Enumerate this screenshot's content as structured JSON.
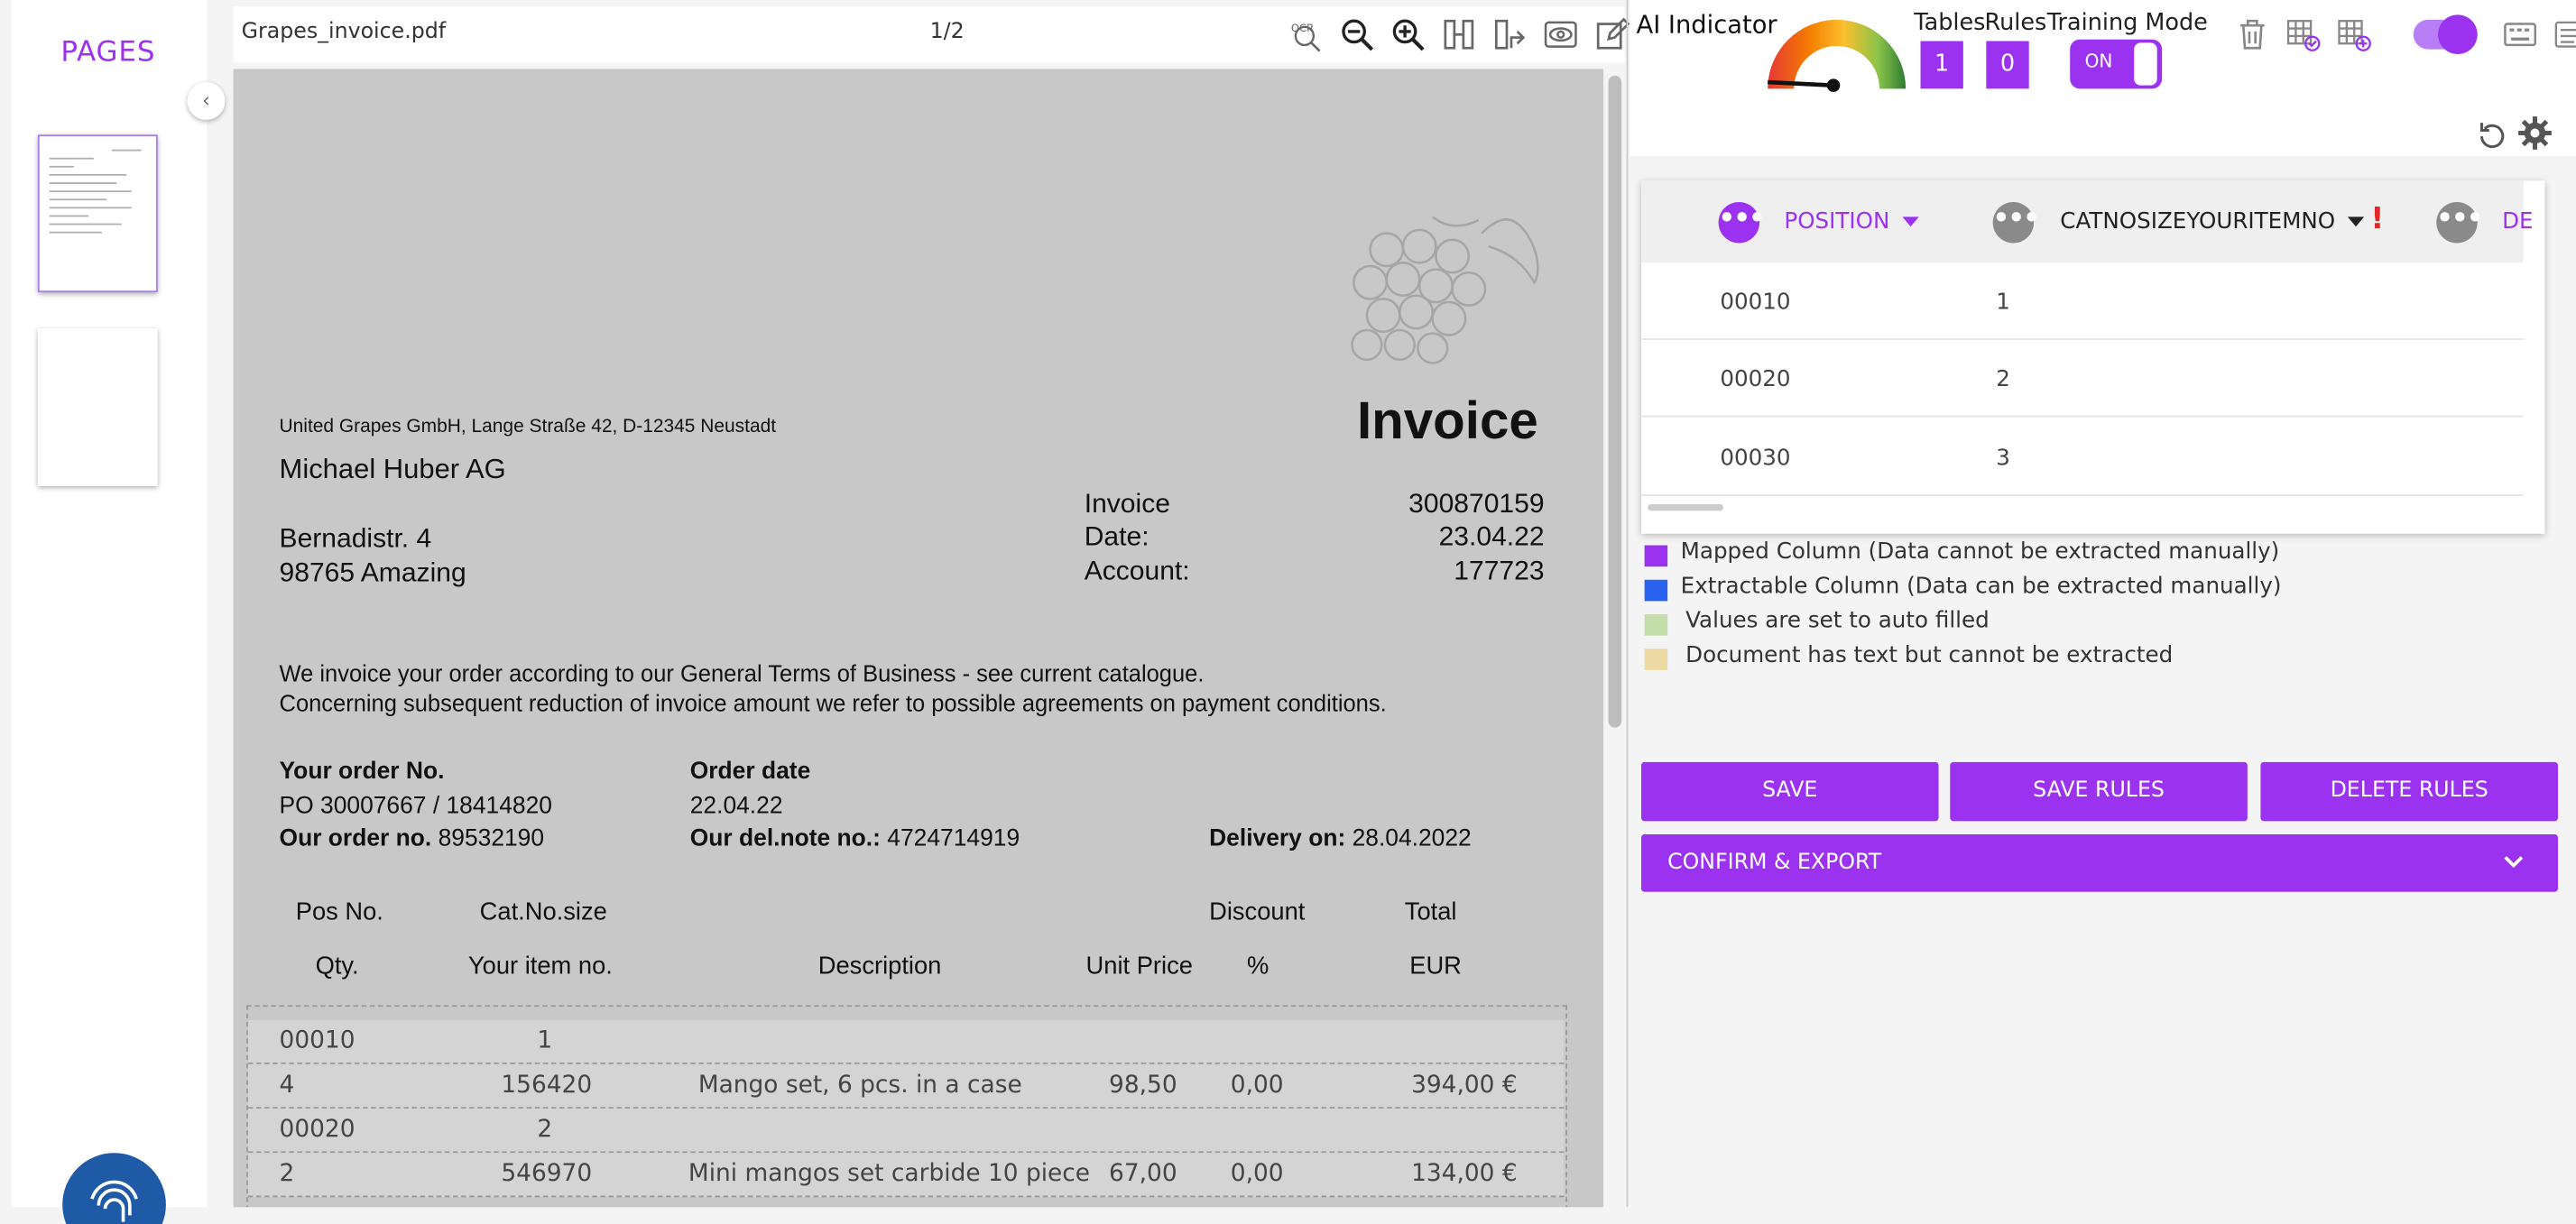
{
  "pages_panel": {
    "title": "PAGES"
  },
  "pdf_toolbar": {
    "file_name": "Grapes_invoice.pdf",
    "page_counter": "1/2",
    "ocr_label": "OCR"
  },
  "invoice": {
    "heading": "Invoice",
    "sender_line": "United Grapes GmbH, Lange Straße 42, D-12345 Neustadt",
    "recipient": {
      "name": "Michael Huber AG",
      "street": "Bernadistr. 4",
      "city": "98765 Amazing"
    },
    "meta": [
      {
        "label": "Invoice",
        "value": "300870159"
      },
      {
        "label": "Date:",
        "value": "23.04.22"
      },
      {
        "label": "Account:",
        "value": "177723"
      }
    ],
    "paragraph_line1": "We invoice your order according to our General Terms of Business - see current catalogue.",
    "paragraph_line2": "Concerning subsequent reduction of invoice amount we refer to possible agreements on payment conditions.",
    "your_order_label": "Your order No.",
    "your_order_value": "PO 30007667 / 18414820",
    "order_date_label": "Order date",
    "order_date_value": "22.04.22",
    "our_order_label": "Our order no.",
    "our_order_value": "89532190",
    "del_note_label": "Our del.note no.:",
    "del_note_value": "4724714919",
    "delivery_label": "Delivery on:",
    "delivery_value": "28.04.2022",
    "columns_row1": {
      "pos": "Pos No.",
      "cat": "Cat.No.size",
      "discount": "Discount",
      "total": "Total"
    },
    "columns_row2": {
      "qty": "Qty.",
      "item": "Your item no.",
      "desc": "Description",
      "unit": "Unit Price",
      "pct": "%",
      "eur": "EUR"
    },
    "item_rows": [
      {
        "a": "00010",
        "b": "1",
        "desc": "",
        "unit": "",
        "disc": "",
        "total": ""
      },
      {
        "a": "4",
        "b": "156420",
        "desc": "Mango set, 6 pcs. in a case",
        "unit": "98,50",
        "disc": "0,00",
        "total": "394,00 €"
      },
      {
        "a": "00020",
        "b": "2",
        "desc": "",
        "unit": "",
        "disc": "",
        "total": ""
      },
      {
        "a": "2",
        "b": "546970",
        "desc": "Mini mangos set carbide 10 piece",
        "unit": "67,00",
        "disc": "0,00",
        "total": "134,00 €"
      }
    ]
  },
  "ai_panel": {
    "ai_indicator_label": "AI Indicator",
    "tables_label": "Tables",
    "tables_value": "1",
    "rules_label": "Rules",
    "rules_value": "0",
    "training_mode_label": "Training Mode",
    "training_toggle_label": "ON"
  },
  "table_card": {
    "columns": [
      {
        "name": "POSITION",
        "color": "#9b32f0"
      },
      {
        "name": "CATNOSIZEYOURITEMNO",
        "color": "#222222"
      },
      {
        "name": "DE",
        "color": "#9b32f0"
      }
    ],
    "warning_mark": "!",
    "rows": [
      {
        "position": "00010",
        "cat": "1"
      },
      {
        "position": "00020",
        "cat": "2"
      },
      {
        "position": "00030",
        "cat": "3"
      }
    ]
  },
  "legend": [
    {
      "color": "#9b32f0",
      "text": "Mapped Column (Data cannot be extracted manually)"
    },
    {
      "color": "#2a62f0",
      "text": "Extractable Column (Data can be extracted manually)"
    },
    {
      "color": "#c3dea8",
      "text": "Values are set to auto filled"
    },
    {
      "color": "#ecd9a4",
      "text": "Document has text but cannot be extracted"
    }
  ],
  "actions": {
    "save": "SAVE",
    "save_rules": "SAVE RULES",
    "delete_rules": "DELETE RULES",
    "confirm_export": "CONFIRM & EXPORT"
  },
  "colors": {
    "accent": "#9b32f0",
    "gauge_gradient": [
      "#e53935",
      "#f57c00",
      "#fbc02d",
      "#8bc34a",
      "#2e7d32"
    ]
  },
  "icons": {
    "toolbar": [
      "ocr-icon",
      "zoom-out-icon",
      "zoom-in-icon",
      "column-split-icon",
      "row-split-icon",
      "preview-icon",
      "edit-icon"
    ],
    "right": [
      "trash-icon",
      "table-check-icon",
      "table-add-icon",
      "keyboard-icon",
      "ocr-keyboard-icon",
      "undo-icon",
      "gear-icon"
    ]
  }
}
